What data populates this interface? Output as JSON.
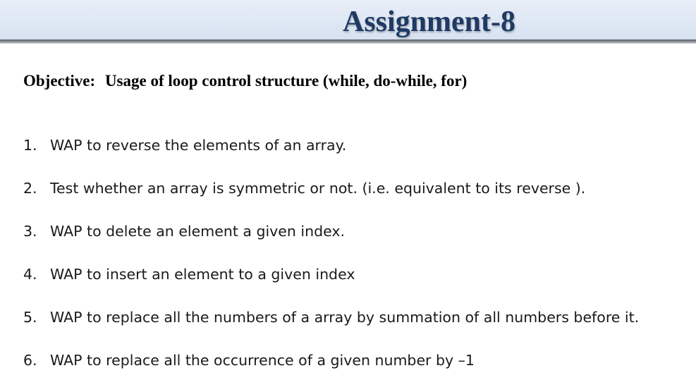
{
  "header": {
    "title": "Assignment-8"
  },
  "objective": {
    "label": "Objective:",
    "text": "Usage of loop control structure (while, do-while, for)"
  },
  "tasks": [
    {
      "number": "1.",
      "text": "WAP to reverse the elements of an array."
    },
    {
      "number": "2.",
      "text": "Test whether an array is symmetric or not. (i.e. equivalent to its reverse )."
    },
    {
      "number": "3.",
      "text": "WAP to delete an element a given index."
    },
    {
      "number": "4.",
      "text": "WAP to insert an element to a given index"
    },
    {
      "number": "5.",
      "text": "WAP to replace all the numbers of a array by summation of all numbers before it."
    },
    {
      "number": "6.",
      "text": "WAP to replace all the occurrence of a given number by  –1"
    }
  ]
}
